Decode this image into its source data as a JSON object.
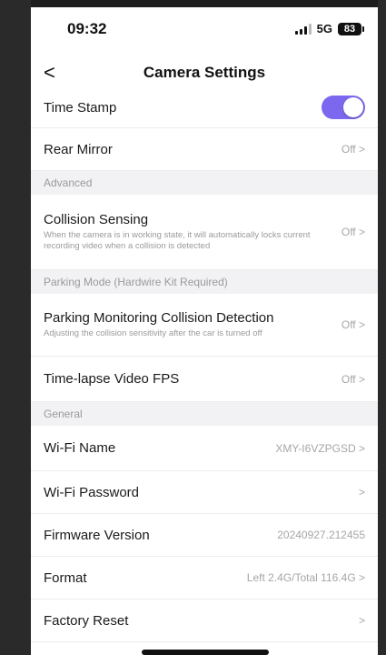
{
  "status_bar": {
    "time": "09:32",
    "network": "5G",
    "battery": "83"
  },
  "nav": {
    "title": "Camera Settings",
    "back_glyph": "<"
  },
  "rows": {
    "time_stamp": {
      "label": "Time Stamp",
      "toggle_on": true
    },
    "rear_mirror": {
      "label": "Rear Mirror",
      "value": "Off >"
    },
    "advanced_header": "Advanced",
    "collision_sensing": {
      "label": "Collision Sensing",
      "desc": "When the camera is in working state, it will automatically locks current recording video when a collision is detected",
      "value": "Off >"
    },
    "parking_header": "Parking Mode (Hardwire Kit Required)",
    "parking_collision": {
      "label": "Parking Monitoring Collision Detection",
      "desc": "Adjusting the collision sensitivity after the car is turned off",
      "value": "Off >"
    },
    "timelapse": {
      "label": "Time-lapse Video FPS",
      "value": "Off >"
    },
    "general_header": "General",
    "wifi_name": {
      "label": "Wi-Fi Name",
      "value": "XMY-I6VZPGSD >"
    },
    "wifi_password": {
      "label": "Wi-Fi Password",
      "value": ">"
    },
    "firmware": {
      "label": "Firmware Version",
      "value": "20240927.212455"
    },
    "format": {
      "label": "Format",
      "value": "Left 2.4G/Total 116.4G >"
    },
    "factory_reset": {
      "label": "Factory Reset",
      "value": ">"
    }
  },
  "colors": {
    "accent": "#7b68ee",
    "section_bg": "#f2f2f4"
  },
  "icons": {
    "back": "back-chevron-icon",
    "signal": "signal-bars-icon",
    "battery": "battery-icon"
  }
}
